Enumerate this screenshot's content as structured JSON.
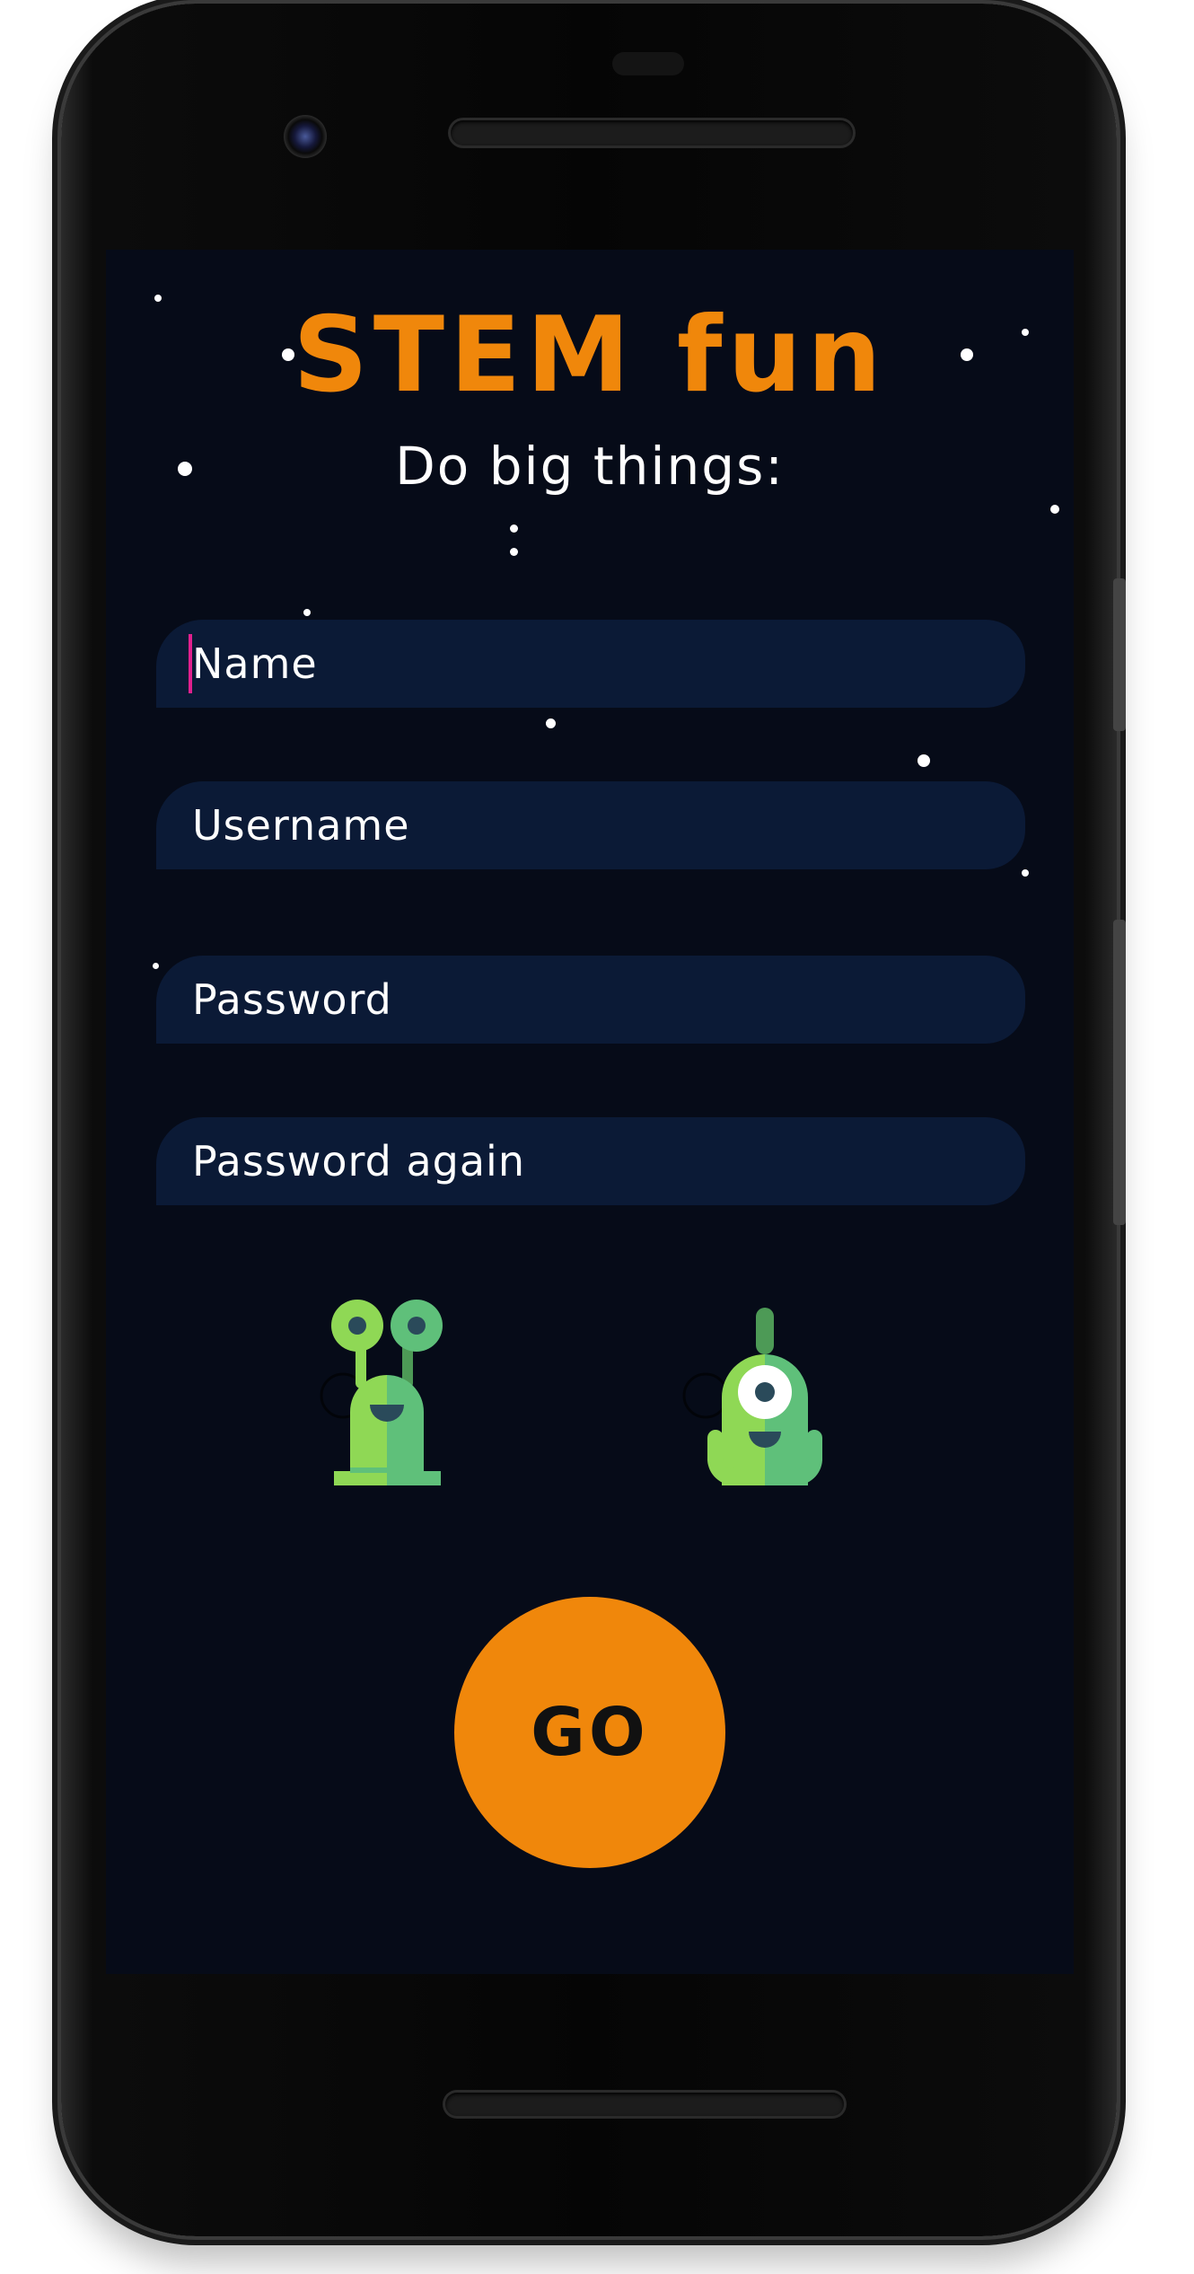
{
  "header": {
    "title": "STEM fun",
    "subtitle": "Do big things:"
  },
  "form": {
    "name_placeholder": "Name",
    "username_placeholder": "Username",
    "password_placeholder": "Password",
    "password_again_placeholder": "Password again"
  },
  "avatars": [
    {
      "icon": "two-eyed-alien-icon",
      "selected": false
    },
    {
      "icon": "one-eyed-alien-icon",
      "selected": false
    }
  ],
  "actions": {
    "go_label": "GO"
  },
  "colors": {
    "background": "#060b18",
    "field": "#0b1a36",
    "accent": "#f0870b",
    "cursor": "#e0208e",
    "alien_light": "#8fd855",
    "alien_dark": "#5fc07a"
  }
}
